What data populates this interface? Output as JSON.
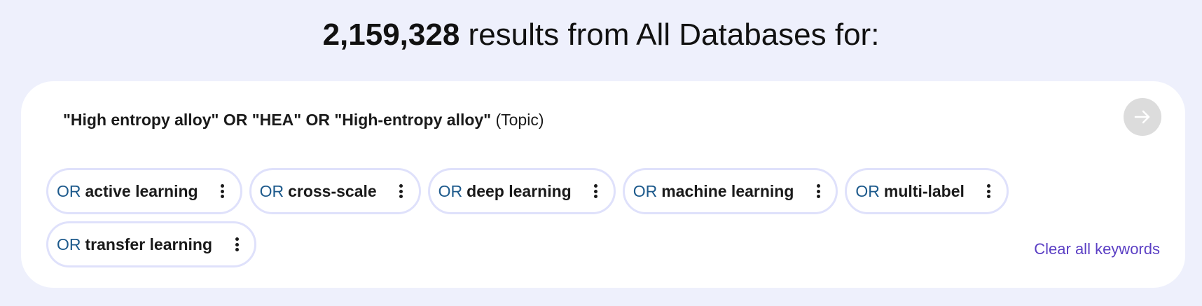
{
  "header": {
    "result_count": "2,159,328",
    "result_text": " results from All Databases for:"
  },
  "query": {
    "terms": "\"High entropy alloy\" OR \"HEA\" OR \"High-entropy alloy\"",
    "field": "(Topic)",
    "submit_icon": "arrow-right-icon"
  },
  "keywords": [
    {
      "operator": "OR",
      "label": "active learning"
    },
    {
      "operator": "OR",
      "label": "cross-scale"
    },
    {
      "operator": "OR",
      "label": "deep learning"
    },
    {
      "operator": "OR",
      "label": "machine learning"
    },
    {
      "operator": "OR",
      "label": "multi-label"
    },
    {
      "operator": "OR",
      "label": "transfer learning"
    }
  ],
  "actions": {
    "clear_all": "Clear all keywords"
  },
  "colors": {
    "background": "#eef0fc",
    "operator": "#1d5a8c",
    "link": "#5b3fc4",
    "chip_border": "#dfe1fb"
  }
}
